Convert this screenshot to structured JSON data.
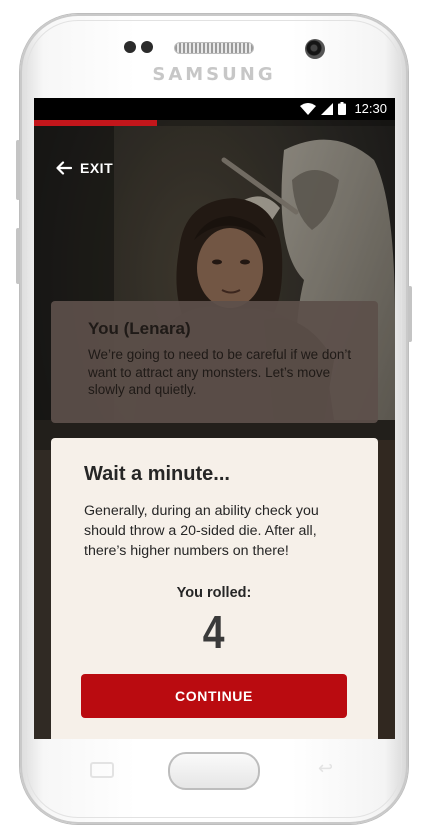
{
  "device": {
    "brand": "SAMSUNG"
  },
  "status_bar": {
    "time": "12:30",
    "icons": [
      "wifi-icon",
      "cell-signal-icon",
      "battery-icon"
    ]
  },
  "story_progress": {
    "fraction": 0.34,
    "color": "#c2161b"
  },
  "nav": {
    "exit_label": "EXIT",
    "exit_icon": "arrow-left-icon"
  },
  "dialogue": {
    "speaker": "You (Lenara)",
    "text": "We’re going to need to be careful if we don’t want to attract any monsters. Let’s move slowly and quietly."
  },
  "roll_dialog": {
    "title": "Wait a minute...",
    "body": "Generally, during an ability check you should throw a 20-sided die. After all, there’s higher numbers on there!",
    "rolled_label": "You rolled:",
    "rolled_value": "4",
    "continue_label": "CONTINUE"
  },
  "colors": {
    "accent": "#ba0b10",
    "dialog_bg": "#f6f0e9",
    "speech_bg": "#5c504a"
  }
}
